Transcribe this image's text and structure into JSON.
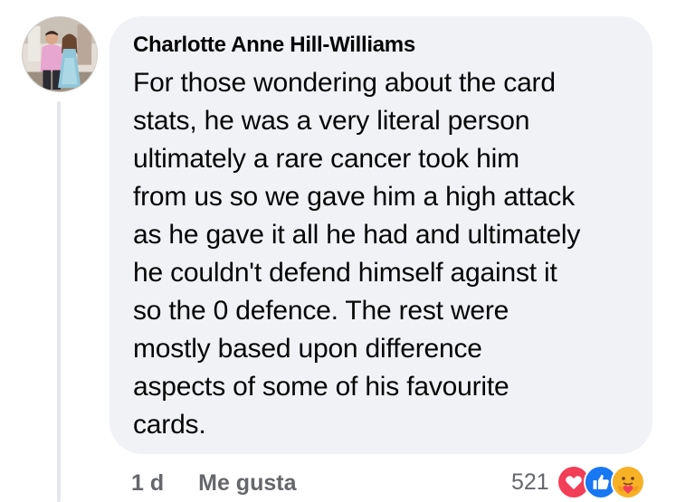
{
  "comment": {
    "author": "Charlotte Anne Hill-Williams",
    "text_lines": [
      "For those wondering about the card",
      "stats, he was a very literal person",
      "ultimately a rare cancer took him",
      "from us so we gave him a high attack",
      "as he gave it all he had and ultimately",
      "he couldn't defend himself against it",
      "so the 0 defence. The rest were",
      "mostly based upon difference",
      "aspects of some of his favourite",
      "cards."
    ],
    "time": "1 d",
    "like_label": "Me gusta",
    "reaction_count": "521",
    "reactions": [
      "love-reaction-icon",
      "like-reaction-icon",
      "care-reaction-icon"
    ]
  },
  "colors": {
    "bubble": "#f0f2f5",
    "text": "#050505",
    "secondary_text": "#65676b",
    "love": "#f33e58",
    "like": "#1877f2",
    "care": "#f7b125"
  }
}
